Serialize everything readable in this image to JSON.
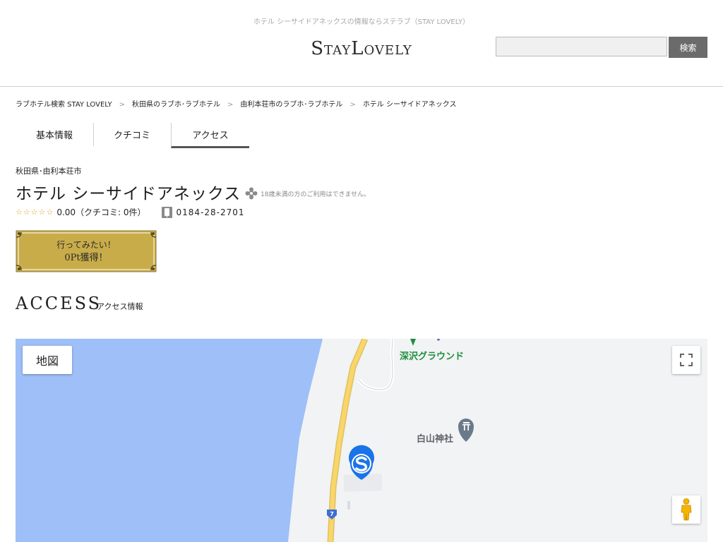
{
  "header": {
    "tagline": "ホテル シーサイドアネックスの情報ならステラブ（STAY LOVELY）",
    "logo": "StayLovely",
    "search_placeholder": "",
    "search_button": "検索"
  },
  "breadcrumb": [
    "ラブホテル検索 STAY LOVELY",
    "秋田県のラブホ･ラブホテル",
    "由利本荘市のラブホ･ラブホテル",
    "ホテル シーサイドアネックス"
  ],
  "breadcrumb_sep": ">",
  "tabs": [
    {
      "label": "基本情報"
    },
    {
      "label": "クチコミ"
    },
    {
      "label": "アクセス",
      "active": true
    }
  ],
  "hotel": {
    "area": "秋田県･由利本荘市",
    "name": "ホテル シーサイドアネックス",
    "age_note": "18歳未満の方のご利用はできません。",
    "stars": "☆☆☆☆☆",
    "rating_text": "0.00（クチコミ: 0件）",
    "phone": "0184-28-2701"
  },
  "want_button": {
    "line1": "行ってみたい！",
    "line2": "0Pt獲得！"
  },
  "access": {
    "title": "ACCESS",
    "subtitle": "アクセス情報"
  },
  "map": {
    "type_button": "地図",
    "label_ground": "深沢グラウンド",
    "label_shrine": "白山神社",
    "route_number": "7",
    "colors": {
      "water": "#9ebff7",
      "land": "#f1f3f4",
      "road": "#f9d66a",
      "pin": "#1a73e8",
      "park": "#1e8e3e",
      "gold": "#c9ac4a"
    }
  }
}
